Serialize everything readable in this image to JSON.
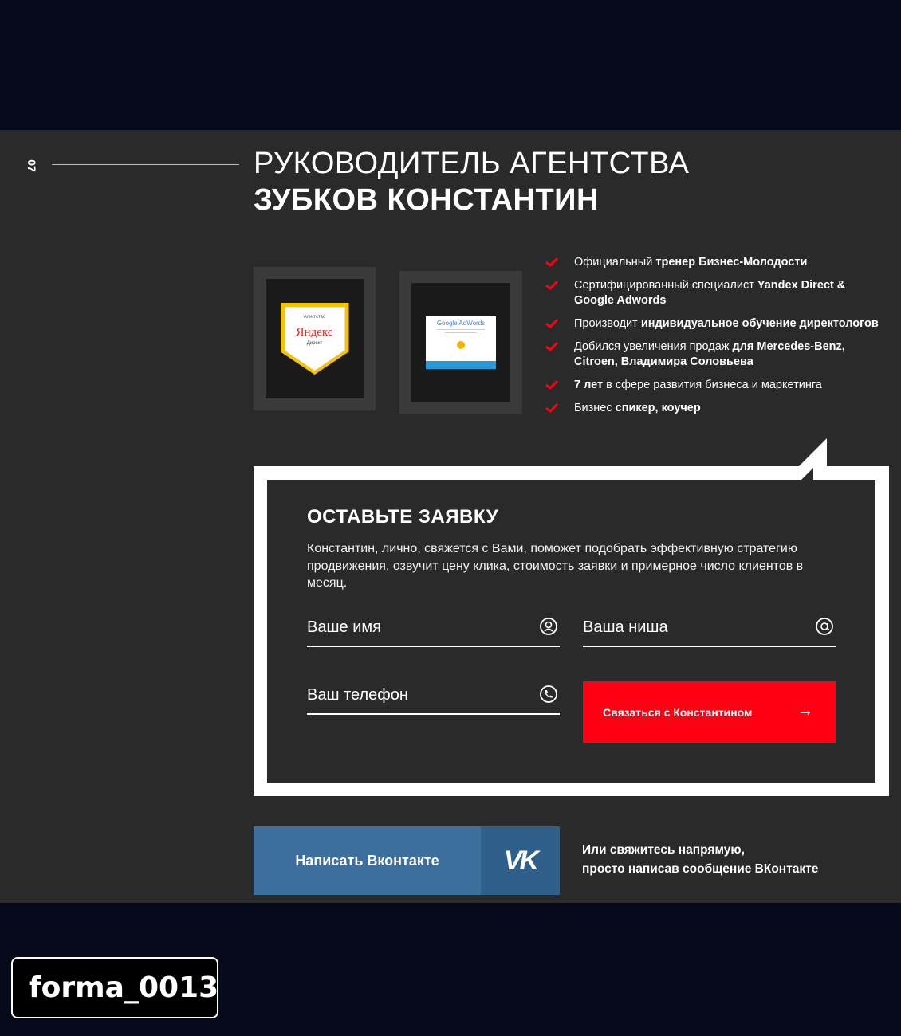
{
  "section": {
    "number": "07"
  },
  "heading": {
    "line1": "РУКОВОДИТЕЛЬ АГЕНТСТВА",
    "line2": "ЗУБКОВ КОНСТАНТИН"
  },
  "certificates": {
    "yandex": {
      "small": "Агентство",
      "name": "Яндекс",
      "sub": "Директ"
    },
    "adwords": {
      "title": "Google AdWords"
    }
  },
  "features": [
    {
      "pre": "Официальный ",
      "bold": "тренер Бизнес-Молодости",
      "post": ""
    },
    {
      "pre": "Сертифицированный специалист ",
      "bold": "Yandex Direct & Google Adwords",
      "post": ""
    },
    {
      "pre": "Производит ",
      "bold": "индивидуальное обучение директологов",
      "post": ""
    },
    {
      "pre": "Добился увеличения продаж ",
      "bold": "для Mercedes-Benz, Citroen, Владимира Соловьева",
      "post": ""
    },
    {
      "pre": "",
      "bold": "7 лет",
      "post": " в сфере развития бизнеса и маркетинга"
    },
    {
      "pre": "Бизнес ",
      "bold": "спикер, коучер",
      "post": ""
    }
  ],
  "form": {
    "title": "ОСТАВЬТЕ ЗАЯВКУ",
    "description": "Константин, лично, свяжется с Вами, поможет подобрать эффективную стратегию продвижения, озвучит цену клика, стоимость заявки и примерное число клиентов в месяц.",
    "name_placeholder": "Ваше имя",
    "niche_placeholder": "Ваша ниша",
    "phone_placeholder": "Ваш телефон",
    "submit_label": "Связаться с Константином",
    "submit_arrow": "→"
  },
  "vk": {
    "button_label": "Написать Вконтакте",
    "logo": "VK",
    "note_line1": "Или свяжитесь напрямую,",
    "note_line2": "просто написав сообщение ВКонтакте"
  },
  "tag": "forma_0013",
  "colors": {
    "accent": "#ff0013",
    "vk": "#3d6f9c",
    "panel": "#2a2a2a",
    "background": "#060a1b"
  }
}
